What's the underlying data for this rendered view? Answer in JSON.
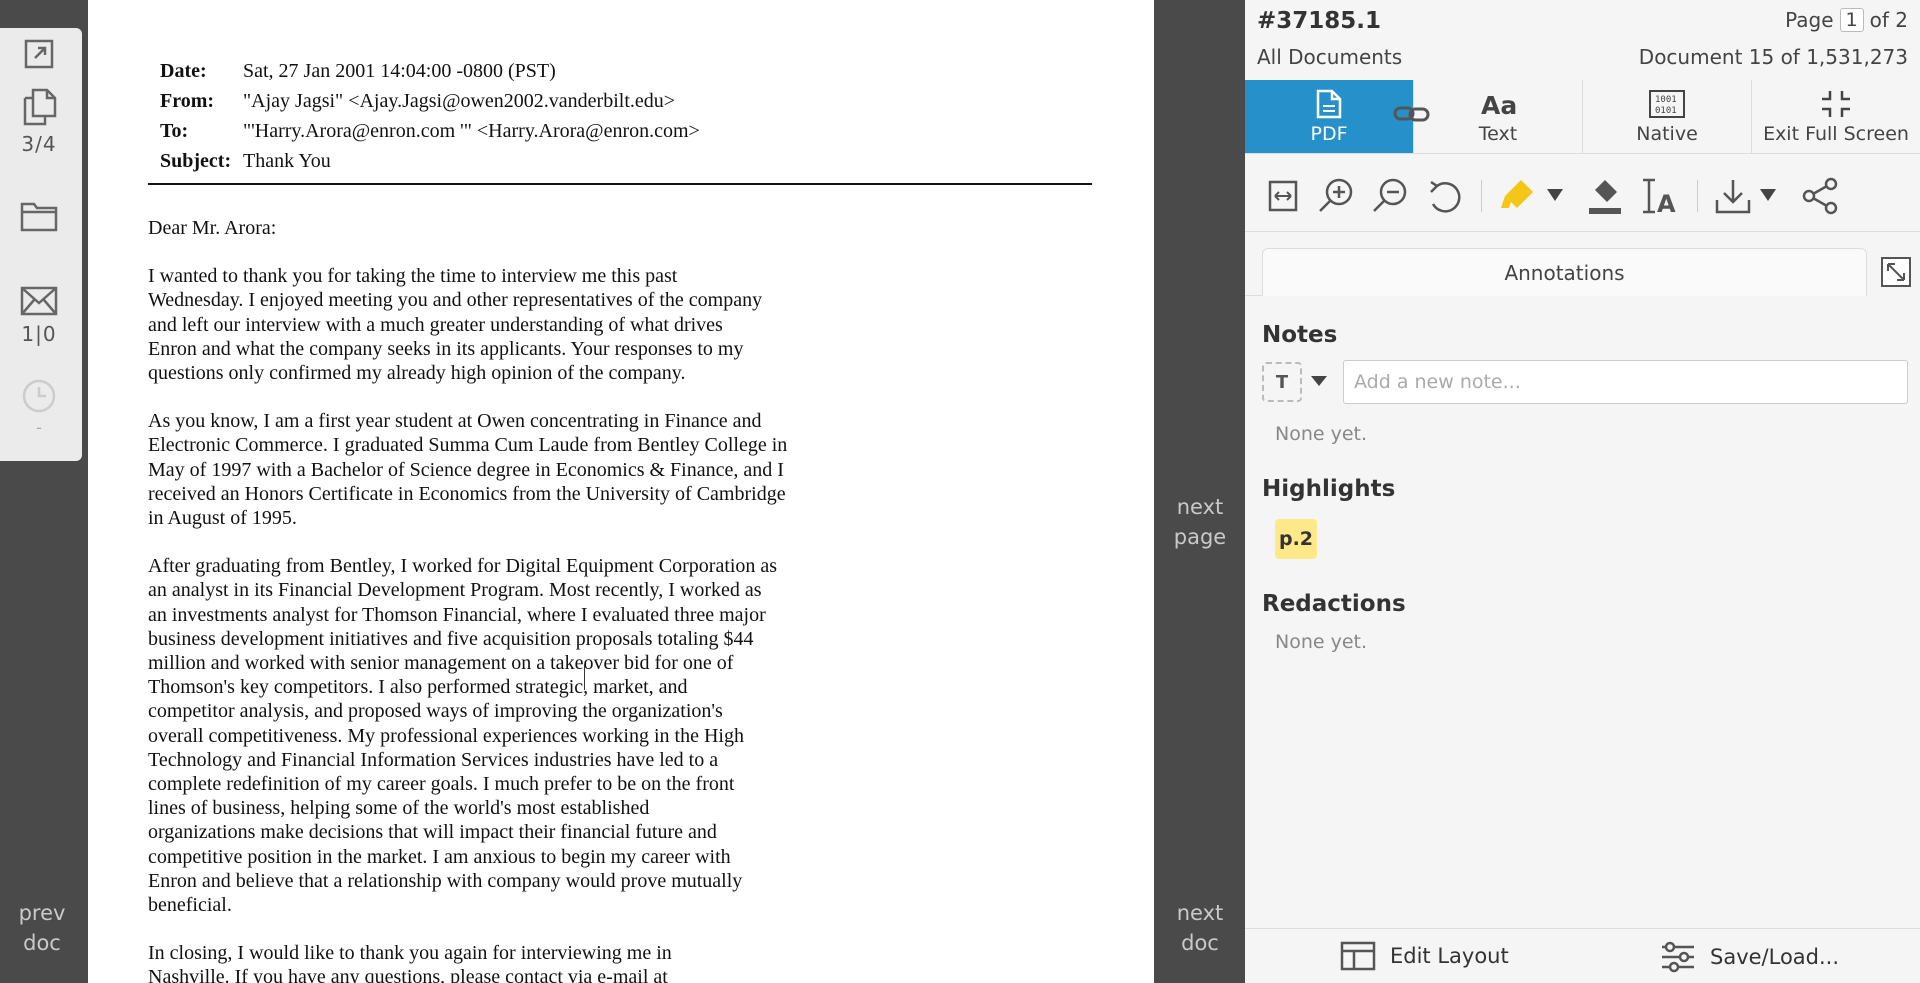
{
  "left_toolbar": {
    "pages_count": "3/4",
    "messages_count": "1|0",
    "history_count": "-"
  },
  "gutter": {
    "prev_doc": "prev\ndoc",
    "next_page": "next\npage",
    "next_doc": "next\ndoc"
  },
  "email": {
    "header": [
      {
        "label": "Date:",
        "value": "Sat, 27 Jan 2001 14:04:00 -0800 (PST)"
      },
      {
        "label": "From:",
        "value": "\"Ajay Jagsi\" <Ajay.Jagsi@owen2002.vanderbilt.edu>"
      },
      {
        "label": "To:",
        "value": "\"'Harry.Arora@enron.com '\" <Harry.Arora@enron.com>"
      },
      {
        "label": "Subject:",
        "value": "Thank You"
      }
    ],
    "body": [
      "Dear Mr. Arora:",
      "I wanted to thank you for taking the time to interview me this past\nWednesday. I enjoyed meeting you and other representatives of the company\nand left our interview with a much greater understanding of what drives\nEnron and what the company seeks in its applicants. Your responses to my\nquestions only confirmed my already high opinion of the company.",
      "As you know, I am a first year student at Owen concentrating in Finance and\nElectronic Commerce. I graduated Summa Cum Laude from Bentley College in\nMay of 1997 with a Bachelor of Science degree in Economics & Finance, and I\nreceived an Honors Certificate in Economics from the University of Cambridge\nin August of 1995.",
      "After graduating from Bentley, I worked for Digital Equipment Corporation as\nan analyst in its Financial Development Program. Most recently, I worked as\nan investments analyst for Thomson Financial, where I evaluated three major\nbusiness development initiatives and five acquisition proposals totaling $44\nmillion and worked with senior management on a takeover bid for one of\nThomson's key competitors. I also performed strategic, market, and\ncompetitor analysis, and proposed ways of improving the organization's\noverall competitiveness. My professional experiences working in the High\nTechnology and Financial Information Services industries have led to a\ncomplete redefinition of my career goals. I much prefer to be on the front\nlines of business, helping some of the world's most established\norganizations make decisions that will impact their financial future and\ncompetitive position in the market. I am anxious to begin my career with\nEnron and believe that a relationship with company would prove mutually\nbeneficial.",
      "In closing, I would like to thank you again for interviewing me in\nNashville. If you have any questions, please contact via e-mail at"
    ]
  },
  "panel": {
    "doc_id": "#37185.1",
    "doc_set": "All Documents",
    "page_label": "Page",
    "page_current": "1",
    "page_total": "of 2",
    "doc_position": "Document 15 of 1,531,273",
    "tabs": {
      "pdf": "PDF",
      "text": "Text",
      "native": "Native",
      "exit": "Exit Full Screen"
    },
    "annotations_tab": "Annotations",
    "notes_title": "Notes",
    "note_type": "T",
    "note_placeholder": "Add a new note...",
    "notes_empty": "None yet.",
    "highlights_title": "Highlights",
    "highlight_badge": "p.2",
    "redactions_title": "Redactions",
    "redactions_empty": "None yet.",
    "edit_layout": "Edit Layout",
    "save_load": "Save/Load..."
  },
  "colors": {
    "accent": "#2590c9",
    "highlight": "#fde98a",
    "highlighter_tool": "#f5c518",
    "gutter": "#4a4a4a"
  }
}
